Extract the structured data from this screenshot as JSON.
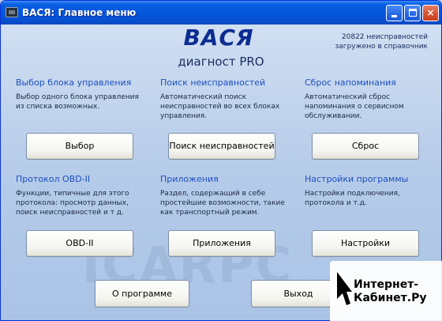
{
  "window": {
    "title": "ВАСЯ:  Главное меню",
    "minimize_label": "",
    "maximize_label": "",
    "close_label": "×"
  },
  "header": {
    "app_name": "ВАСЯ",
    "subtitle": "диагност PRO",
    "info_line1": "20822 неисправностей",
    "info_line2": "загружено в справочник"
  },
  "panels": [
    {
      "title": "Выбор блока управления",
      "desc_lines": [
        "Выбор одного блока управления",
        "из списка возможных."
      ],
      "button": "Выбор"
    },
    {
      "title": "Поиск неисправностей",
      "desc_lines": [
        "Автоматический поиск",
        "неисправностей во всех блоках",
        "управления."
      ],
      "button": "Поиск неисправностей"
    },
    {
      "title": "Сброс напоминания",
      "desc_lines": [
        "Автоматический сброс",
        "напоминания о сервисном",
        "обслуживании."
      ],
      "button": "Сброс"
    },
    {
      "title": "Протокол OBD-II",
      "desc_lines": [
        "Функции, типичные для этого",
        "протокола: просмотр данных,",
        "поиск неисправностей и т д."
      ],
      "button": "OBD-II"
    },
    {
      "title": "Приложения",
      "desc_lines": [
        "Раздел, содержащий в себе",
        "простейшие возможности, такие",
        "как транспортный режим."
      ],
      "button": "Приложения"
    },
    {
      "title": "Настройки программы",
      "desc_lines": [
        "Настройки подключения,",
        "протокола и т.д."
      ],
      "button": "Настройки"
    }
  ],
  "footer": {
    "about_button": "О программе",
    "exit_button": "Выход"
  },
  "watermark": {
    "text": "ICARPC"
  },
  "overlay": {
    "line1": "Интернет-",
    "line2": "Кабинет.Ру"
  },
  "colors": {
    "titlebar": "#0556dd",
    "background": "#b5cbe9",
    "panel_title": "#1f4fc1",
    "app_name": "#0b2c92"
  }
}
